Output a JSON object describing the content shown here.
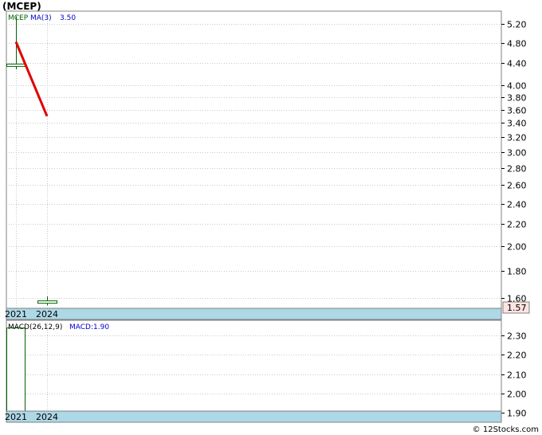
{
  "title": "(MCEP)",
  "watermark": "© 12Stocks.com",
  "colors": {
    "price": "#006400",
    "ma": "#e00000",
    "grid": "#c8c8c8",
    "axis_band": "#add8e6",
    "legend_ma": "#0000cc",
    "price_tag_bg": "#ffe4e1"
  },
  "chart_data": [
    {
      "type": "candlestick",
      "title": "(MCEP)",
      "legend": {
        "ticker": "MCEP",
        "ma_label": "MA(3)",
        "ma_value": "3.50"
      },
      "x_categories": [
        "2021",
        "2024"
      ],
      "yscale": "log",
      "ylim": [
        1.53,
        5.5
      ],
      "yticks": [
        "5.20",
        "4.80",
        "4.40",
        "4.00",
        "3.80",
        "3.60",
        "3.40",
        "3.20",
        "3.00",
        "2.80",
        "2.60",
        "2.40",
        "2.20",
        "2.00",
        "1.80",
        "1.60"
      ],
      "last_price": "1.57",
      "candles": [
        {
          "x": "2021",
          "open": 4.34,
          "high": 5.38,
          "low": 4.28,
          "close": 4.38
        },
        {
          "x": "2024",
          "open": 1.57,
          "high": 1.61,
          "low": 1.55,
          "close": 1.58
        }
      ],
      "ma": [
        {
          "x": "2021",
          "value": 4.82
        },
        {
          "x": "2024",
          "value": 3.5
        }
      ],
      "grid": true
    },
    {
      "type": "bar",
      "title": "MACD(26,12,9)",
      "legend": {
        "label": "MACD(26,12,9)",
        "value_label": "MACD:1.90"
      },
      "x_categories": [
        "2021",
        "2024"
      ],
      "ylim": [
        1.85,
        2.38
      ],
      "yticks": [
        "2.30",
        "2.20",
        "2.10",
        "2.00",
        "1.90"
      ],
      "bars": [
        {
          "x": "2021",
          "value": 2.34
        }
      ],
      "grid": true
    }
  ]
}
